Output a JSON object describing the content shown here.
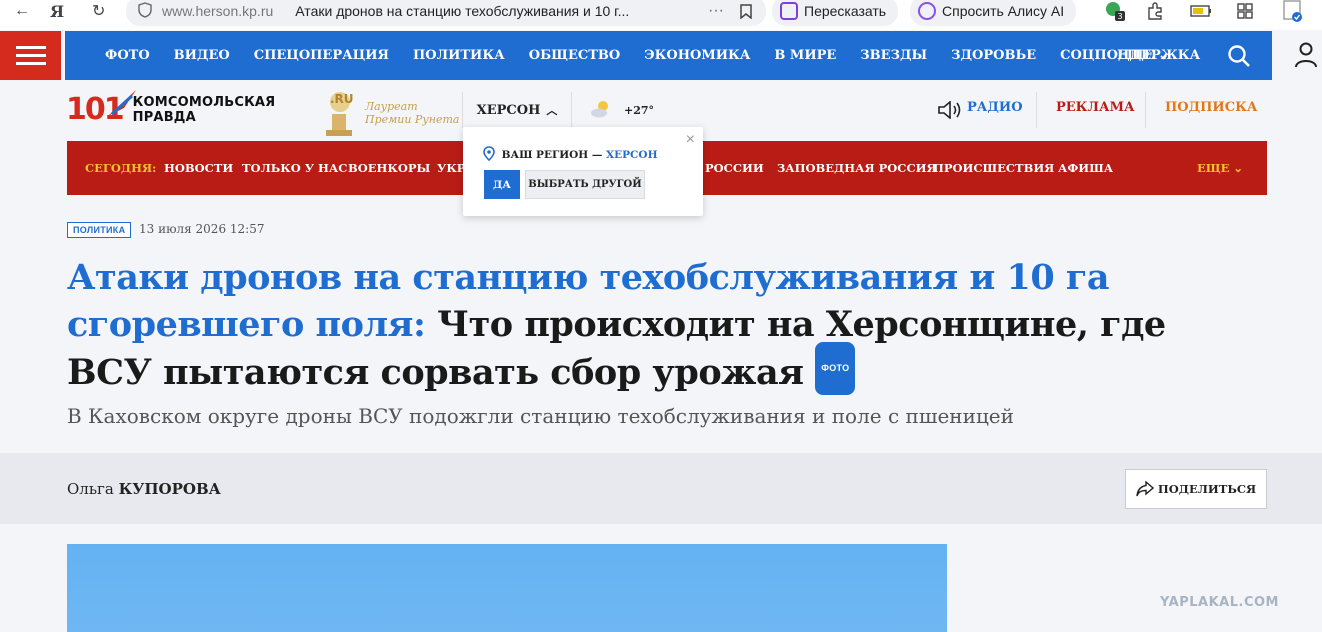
{
  "browser": {
    "domain": "www.herson.kp.ru",
    "tab_title": "Атаки дронов на станцию техобслуживания и 10 г...",
    "more": "···",
    "retell_label": "Пересказать",
    "alice_label": "Спросить Алису AI",
    "badge_count": "3",
    "icons": [
      "back-icon",
      "yandex-icon",
      "reload-icon",
      "shield-icon",
      "more-icon",
      "bookmark-icon",
      "retell-icon",
      "alice-icon",
      "extension-icon",
      "puzzle-icon",
      "battery-icon",
      "collections-icon",
      "profile-icon"
    ]
  },
  "top_nav": {
    "items": [
      "ФОТО",
      "ВИДЕО",
      "СПЕЦОПЕРАЦИЯ",
      "ПОЛИТИКА",
      "ОБЩЕСТВО",
      "ЭКОНОМИКА",
      "В МИРЕ",
      "ЗВЕЗДЫ",
      "ЗДОРОВЬЕ",
      "СОЦПОДДЕРЖКА"
    ],
    "more_label": "ЕЩЕ",
    "color": "#1f6dd1"
  },
  "header": {
    "logo_number": "101",
    "logo_name_line1": "КОМСОМОЛЬСКАЯ",
    "logo_name_line2": "ПРАВДА",
    "award_badge": ".RU",
    "laureate_line1": "Лауреат",
    "laureate_line2": "Премии Рунета",
    "region": "ХЕРСОН",
    "temperature": "+27°",
    "radio_label": "РАДИО",
    "ads_label": "РЕКЛАМА",
    "subscribe_label": "ПОДПИСКА"
  },
  "red_nav": {
    "today_label": "СЕГОДНЯ:",
    "items": [
      "НОВОСТИ",
      "ТОЛЬКО У НАС",
      "ВОЕНКОРЫ",
      "УКР",
      "РОССИИ",
      "ЗАПОВЕДНАЯ РОССИЯ",
      "ПРОИСШЕСТВИЯ",
      "АФИША"
    ],
    "more_label": "ЕЩЕ",
    "color": "#b81c14"
  },
  "region_popup": {
    "question": "ВАШ РЕГИОН —",
    "city": "ХЕРСОН",
    "yes_label": "ДА",
    "other_label": "ВЫБРАТЬ ДРУГОЙ",
    "close": "×"
  },
  "article": {
    "rubric": "ПОЛИТИКА",
    "date": "13 июля 2026 12:57",
    "headline_highlight": "Атаки дронов на станцию техобслуживания и 10 га сгоревшего поля:",
    "headline_rest": " Что происходит на Херсонщине, где ВСУ пытаются сорвать сбор урожая",
    "photo_badge": "ФОТО",
    "lead": "В Каховском округе дроны ВСУ подожгли станцию техобслуживания и поле с пшеницей",
    "author_first": "Ольга",
    "author_last": "КУПОРОВА",
    "share_label": "ПОДЕЛИТЬСЯ"
  },
  "watermark": "YAPLAKAL.COM"
}
